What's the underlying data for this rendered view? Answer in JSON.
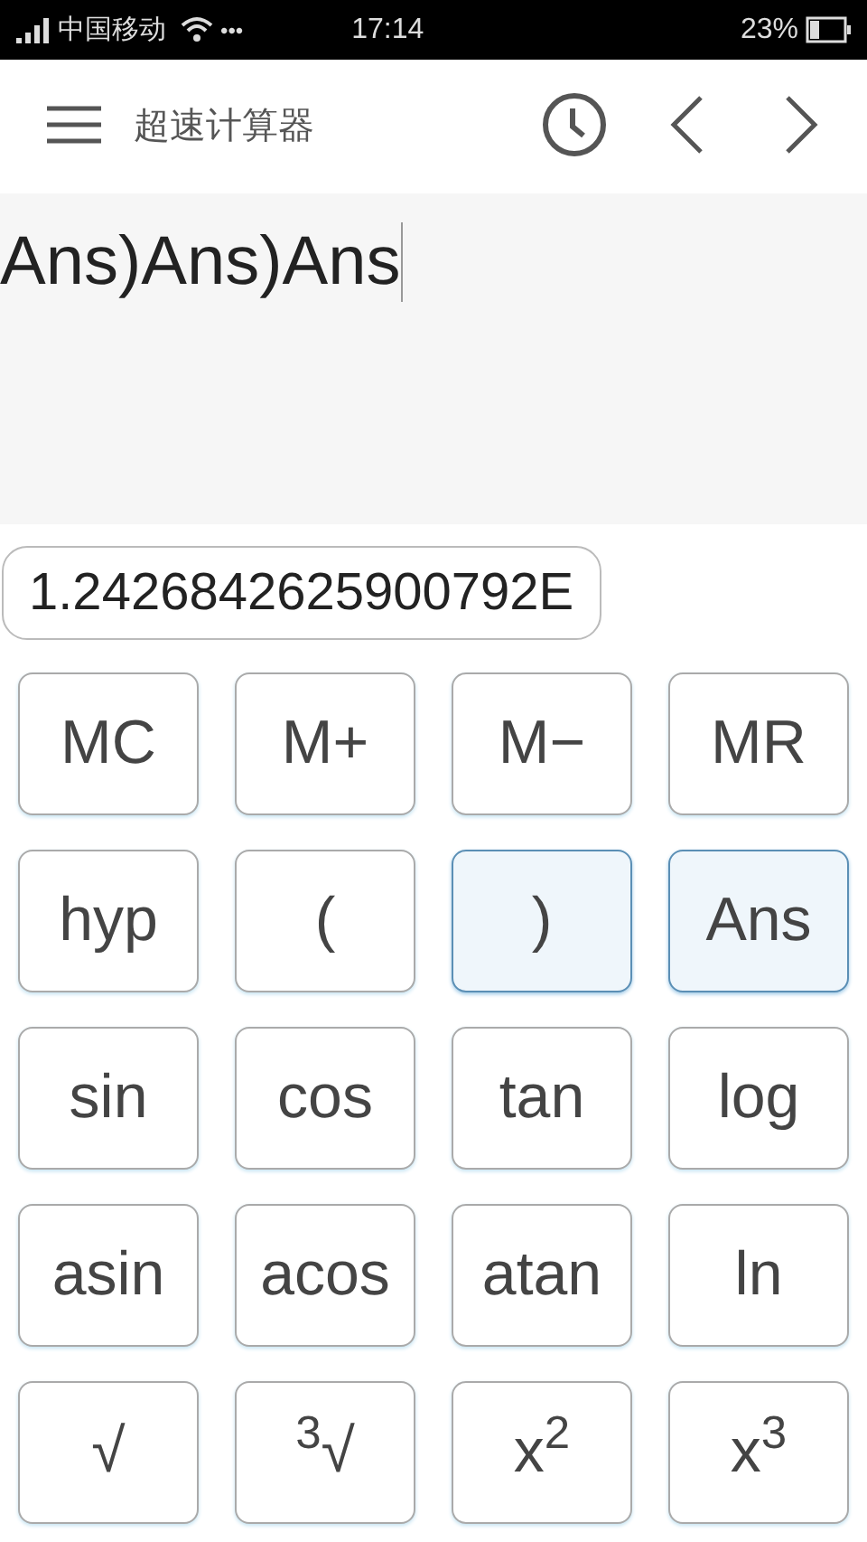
{
  "status_bar": {
    "carrier": "中国移动",
    "more": "•••",
    "time": "17:14",
    "battery": "23%"
  },
  "app_bar": {
    "title": "超速计算器"
  },
  "expression": {
    "value": "Ans)Ans)Ans"
  },
  "result": {
    "value": "1.2426842625900792E"
  },
  "keys": [
    {
      "label": "MC",
      "highlighted": false
    },
    {
      "label": "M+",
      "highlighted": false
    },
    {
      "label": "M−",
      "highlighted": false
    },
    {
      "label": "MR",
      "highlighted": false
    },
    {
      "label": "hyp",
      "highlighted": false
    },
    {
      "label": "(",
      "highlighted": false
    },
    {
      "label": ")",
      "highlighted": true
    },
    {
      "label": "Ans",
      "highlighted": true
    },
    {
      "label": "sin",
      "highlighted": false
    },
    {
      "label": "cos",
      "highlighted": false
    },
    {
      "label": "tan",
      "highlighted": false
    },
    {
      "label": "log",
      "highlighted": false
    },
    {
      "label": "asin",
      "highlighted": false
    },
    {
      "label": "acos",
      "highlighted": false
    },
    {
      "label": "atan",
      "highlighted": false
    },
    {
      "label": "ln",
      "highlighted": false
    },
    {
      "label": "√",
      "highlighted": false
    },
    {
      "label": "$^{3}$√",
      "highlighted": false
    },
    {
      "label": "x$^{2}$",
      "highlighted": false
    },
    {
      "label": "x$^{3}$",
      "highlighted": false
    }
  ]
}
